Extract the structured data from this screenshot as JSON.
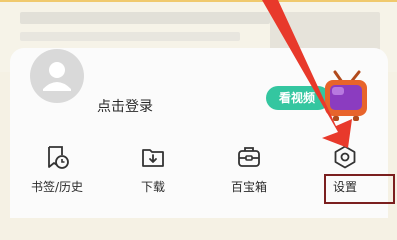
{
  "profile": {
    "login_label": "点击登录"
  },
  "promo": {
    "label": "看视频"
  },
  "tools": [
    {
      "label": "书签/历史",
      "icon": "bookmark-history-icon"
    },
    {
      "label": "下载",
      "icon": "download-icon"
    },
    {
      "label": "百宝箱",
      "icon": "toolbox-icon"
    },
    {
      "label": "设置",
      "icon": "settings-hexagon-icon"
    }
  ],
  "colors": {
    "promo_green": "#34c6a0",
    "annotation_arrow": "#e8392b",
    "annotation_box": "#7b1f1f"
  }
}
